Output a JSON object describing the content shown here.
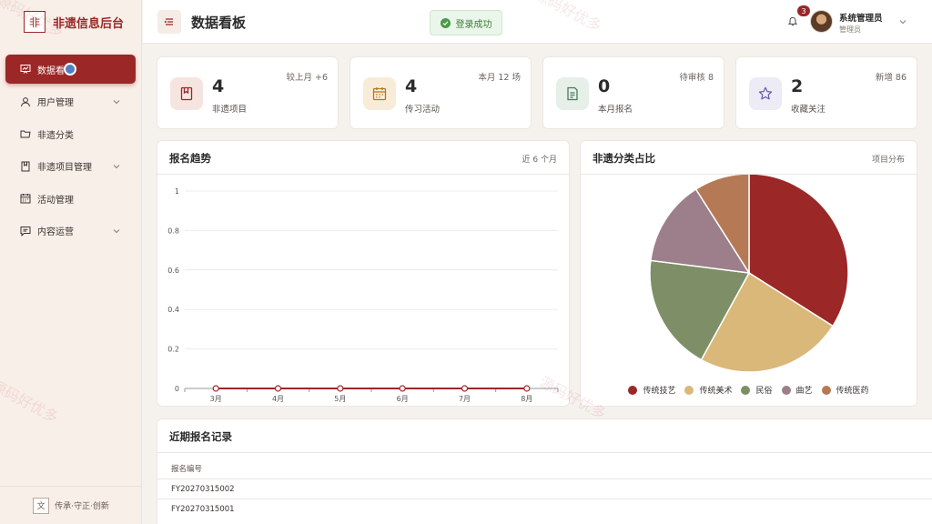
{
  "sidebar": {
    "brand_logo_char": "非",
    "brand_name": "非遗信息后台",
    "items": [
      {
        "label": "数据看板",
        "icon": "chart-icon"
      },
      {
        "label": "用户管理",
        "icon": "user-icon"
      },
      {
        "label": "非遗分类",
        "icon": "folder-icon"
      },
      {
        "label": "非遗项目管理",
        "icon": "book-icon"
      },
      {
        "label": "活动管理",
        "icon": "calendar-icon"
      },
      {
        "label": "内容运营",
        "icon": "message-icon"
      }
    ],
    "footer_logo_char": "文",
    "footer_text": "传承·守正·创新"
  },
  "header": {
    "title": "数据看板",
    "toast": "登录成功",
    "notification_count": "3",
    "user_name": "系统管理员",
    "user_role": "管理员"
  },
  "stats": [
    {
      "value": "4",
      "label": "非遗项目",
      "extra": "较上月 +6",
      "icon": "book-icon",
      "color": "#9b2727",
      "bg": "#f6e4e1"
    },
    {
      "value": "4",
      "label": "传习活动",
      "extra": "本月 12 场",
      "icon": "calendar-icon",
      "color": "#b5791e",
      "bg": "#f8ecd9"
    },
    {
      "value": "0",
      "label": "本月报名",
      "extra": "待审核 8",
      "icon": "document-icon",
      "color": "#4c7a5a",
      "bg": "#e6f0e8"
    },
    {
      "value": "2",
      "label": "收藏关注",
      "extra": "新增 86",
      "icon": "star-icon",
      "color": "#6a5aa8",
      "bg": "#ecebf6"
    }
  ],
  "trend_panel": {
    "title": "报名趋势",
    "subtitle": "近 6 个月"
  },
  "pie_panel": {
    "title": "非遗分类占比",
    "subtitle": "项目分布"
  },
  "records_panel": {
    "title": "近期报名记录",
    "column_header": "报名编号",
    "rows": [
      "FY20270315002",
      "FY20270315001"
    ]
  },
  "watermark_text": "源码好优多",
  "colors": {
    "primary": "#9b2727",
    "success": "#4a9a47"
  },
  "chart_data": [
    {
      "type": "line",
      "x": [
        "3月",
        "4月",
        "5月",
        "6月",
        "7月",
        "8月"
      ],
      "series": [
        {
          "values": [
            0,
            0,
            0,
            0,
            0,
            0
          ]
        }
      ],
      "ylim": [
        0,
        1
      ],
      "yticks": [
        "0",
        "0.2",
        "0.4",
        "0.6",
        "0.8",
        "1"
      ],
      "grid": true,
      "color": "#9b2727"
    },
    {
      "type": "pie",
      "categories": [
        "传统技艺",
        "传统美术",
        "民俗",
        "曲艺",
        "传统医药"
      ],
      "values": [
        34,
        24,
        19,
        14,
        9
      ],
      "colors": [
        "#9b2727",
        "#d9b87a",
        "#7e8f68",
        "#9c7f8a",
        "#b57a55"
      ],
      "legend": "bottom"
    }
  ]
}
